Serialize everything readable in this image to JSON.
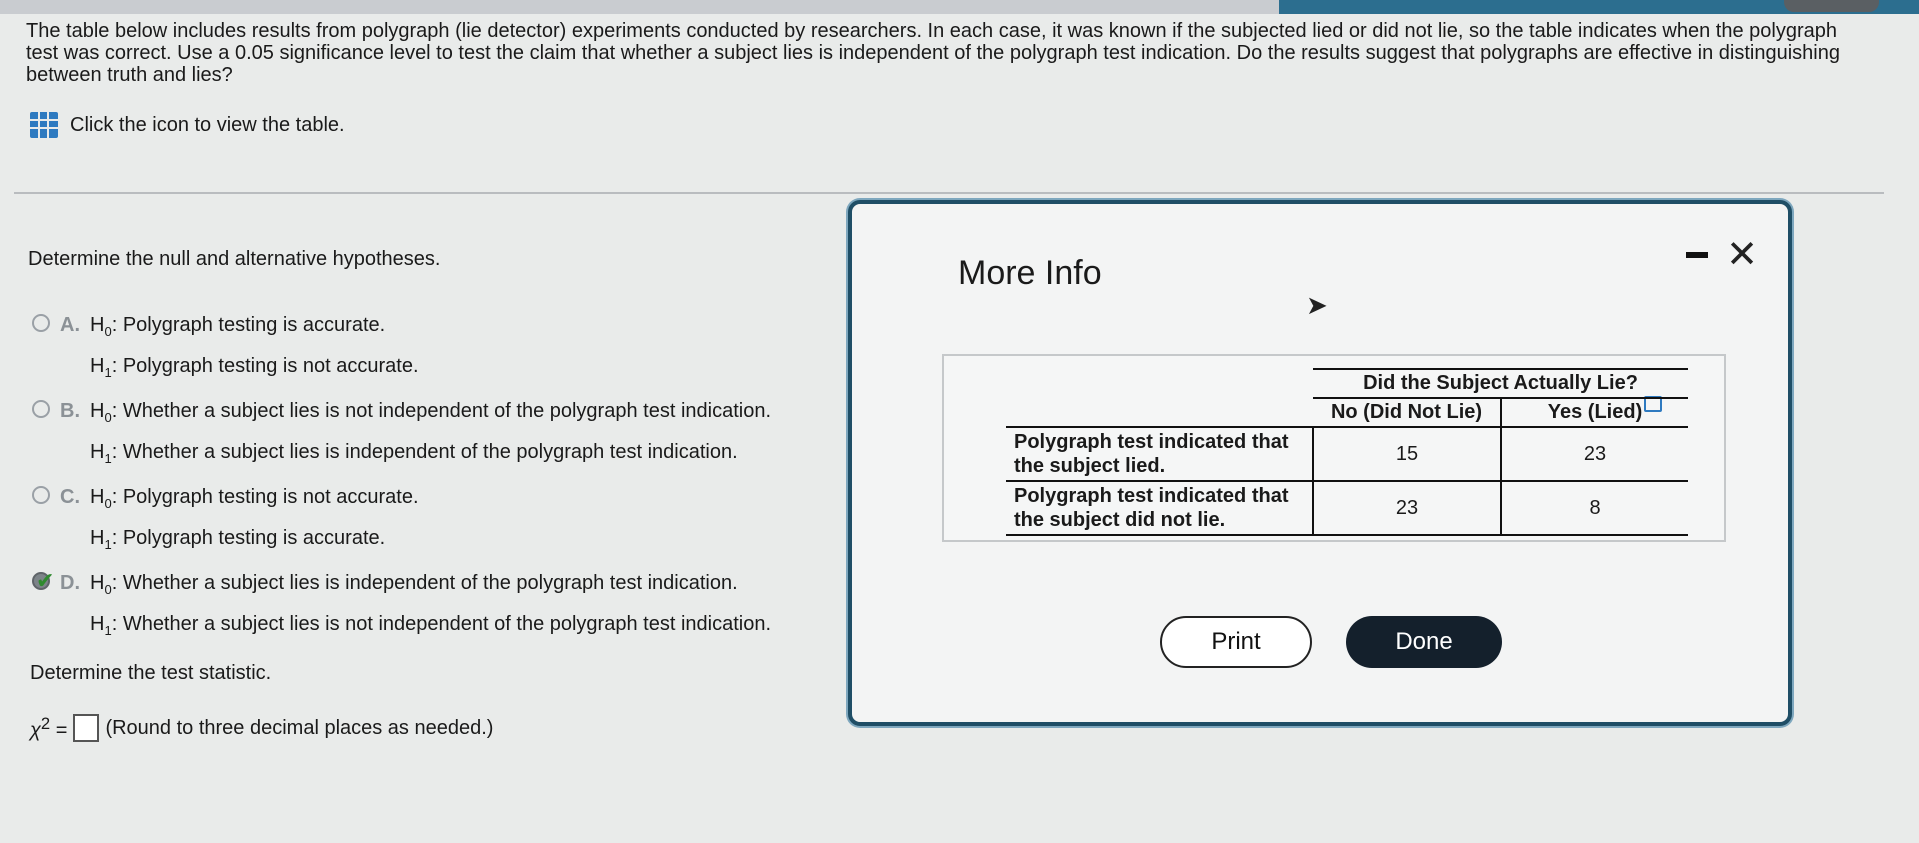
{
  "question": {
    "text": "The table below includes results from polygraph (lie detector) experiments conducted by researchers. In each case, it was known if the subjected lied or did not lie, so the table indicates when the polygraph test was correct. Use a 0.05 significance level to test the claim that whether a subject lies is independent of the polygraph test indication. Do the results suggest that polygraphs are effective in distinguishing between truth and lies?",
    "table_link": "Click the icon to view the table."
  },
  "hypotheses": {
    "prompt": "Determine the null and alternative hypotheses.",
    "options": [
      {
        "letter": "A.",
        "h0": "Polygraph testing is accurate.",
        "h1": "Polygraph testing is not accurate."
      },
      {
        "letter": "B.",
        "h0": "Whether a subject lies is not independent of the polygraph test indication.",
        "h1": "Whether a subject lies is independent of the polygraph test indication."
      },
      {
        "letter": "C.",
        "h0": "Polygraph testing is not accurate.",
        "h1": "Polygraph testing is accurate."
      },
      {
        "letter": "D.",
        "h0": "Whether a subject lies is independent of the polygraph test indication.",
        "h1": "Whether a subject lies is not independent of the polygraph test indication."
      }
    ],
    "selected": "D."
  },
  "test_statistic": {
    "prompt": "Determine the test statistic.",
    "hint": "(Round to three decimal places as needed.)",
    "value": ""
  },
  "modal": {
    "title": "More Info",
    "table": {
      "top_header": "Did the Subject Actually Lie?",
      "col_headers": [
        "No (Did Not Lie)",
        "Yes (Lied)"
      ],
      "rows": [
        {
          "label_line1": "Polygraph test indicated that",
          "label_line2": "the subject lied.",
          "values": [
            "15",
            "23"
          ]
        },
        {
          "label_line1": "Polygraph test indicated that",
          "label_line2": "the subject did not lie.",
          "values": [
            "23",
            "8"
          ]
        }
      ]
    },
    "print_label": "Print",
    "done_label": "Done"
  }
}
